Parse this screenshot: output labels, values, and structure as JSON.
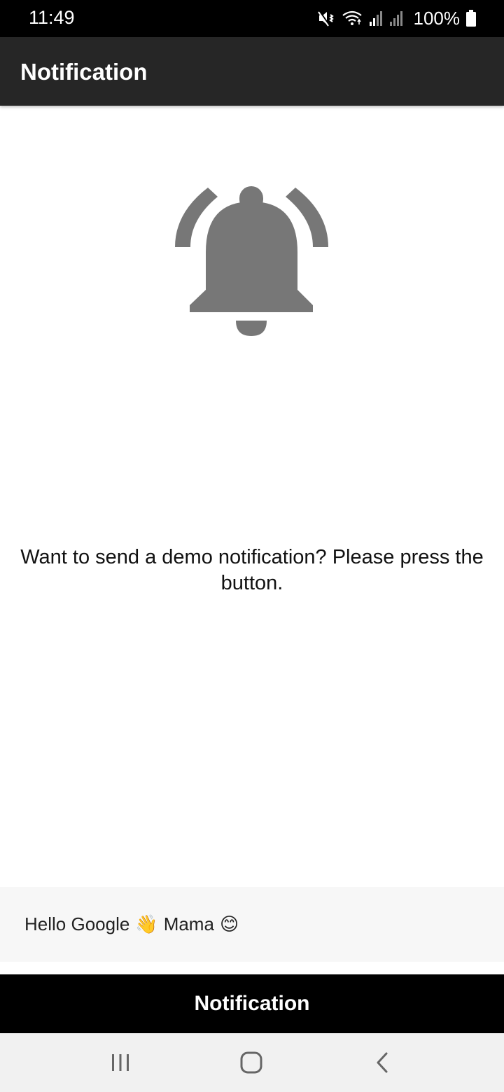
{
  "status_bar": {
    "time": "11:49",
    "battery_percent": "100%",
    "icons": [
      "mute-vibrate-icon",
      "wifi-icon",
      "signal-icon",
      "signal-icon",
      "battery-icon"
    ]
  },
  "app_bar": {
    "title": "Notification"
  },
  "main": {
    "icon": "bell-ringing-icon",
    "icon_color": "#777777",
    "prompt": "Want to send a demo notification? Please press the button."
  },
  "message": {
    "text_part1": "Hello Google",
    "emoji1": "👋",
    "text_part2": "Mama",
    "emoji2": "😊"
  },
  "action_button": {
    "label": "Notification"
  },
  "nav_bar": {
    "items": [
      "recents-icon",
      "home-icon",
      "back-icon"
    ]
  },
  "colors": {
    "status_bar_bg": "#000000",
    "app_bar_bg": "#262626",
    "button_bg": "#000000",
    "panel_bg": "#f7f7f7",
    "nav_bg": "#f1f1f1"
  }
}
